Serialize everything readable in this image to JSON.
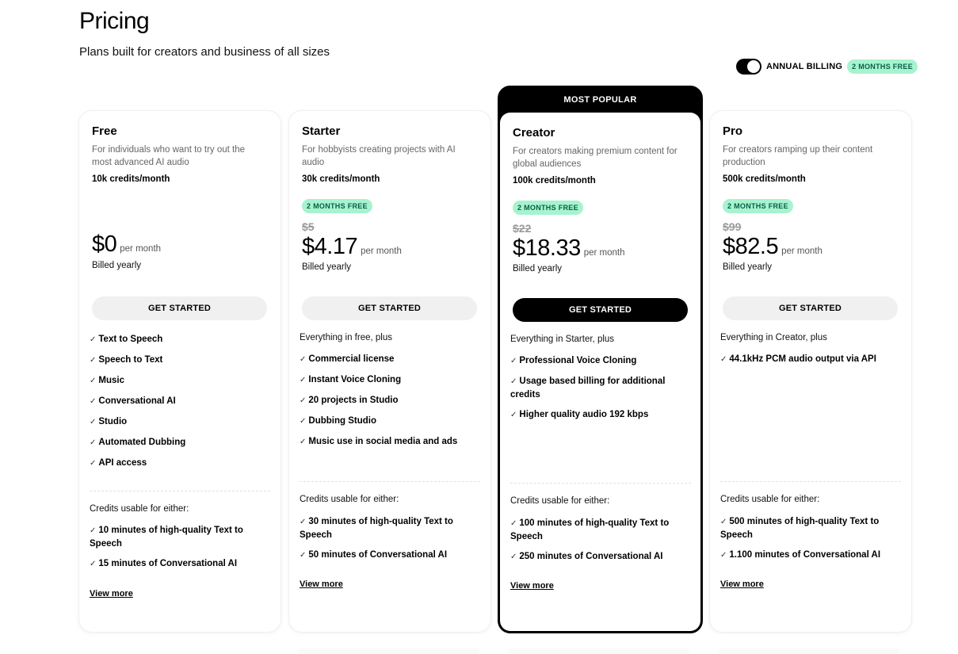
{
  "header": {
    "title": "Pricing",
    "subtitle": "Plans built for creators and business of all sizes"
  },
  "billing": {
    "label": "ANNUAL BILLING",
    "badge": "2 MONTHS FREE",
    "enabled": true
  },
  "colors": {
    "accent_badge_bg": "#a7f3cf",
    "accent_badge_text": "#065f46",
    "primary": "#000000"
  },
  "plans": [
    {
      "name": "Free",
      "description": "For individuals who want to try out the most advanced AI audio",
      "credits": "10k credits/month",
      "price": "$0",
      "per": "per month",
      "billed": "Billed yearly",
      "cta": "GET STARTED",
      "features": [
        "Text to Speech",
        "Speech to Text",
        "Music",
        "Conversational AI",
        "Studio",
        "Automated Dubbing",
        "API access"
      ],
      "usable_label": "Credits usable for either:",
      "usable": [
        "10 minutes of high-quality Text to Speech",
        "15 minutes of Conversational AI"
      ],
      "view_more": "View more"
    },
    {
      "name": "Starter",
      "description": "For hobbyists creating projects with AI audio",
      "credits": "30k credits/month",
      "badge": "2 MONTHS FREE",
      "old_price": "$5",
      "price": "$4.17",
      "per": "per month",
      "billed": "Billed yearly",
      "cta": "GET STARTED",
      "intro": "Everything in free, plus",
      "features": [
        "Commercial license",
        "Instant Voice Cloning",
        "20 projects in Studio",
        "Dubbing Studio",
        "Music use in social media and ads"
      ],
      "usable_label": "Credits usable for either:",
      "usable": [
        "30 minutes of high-quality Text to Speech",
        "50 minutes of Conversational AI"
      ],
      "view_more": "View more"
    },
    {
      "name": "Creator",
      "popular_label": "MOST POPULAR",
      "description": "For creators making premium content for global audiences",
      "credits": "100k credits/month",
      "badge": "2 MONTHS FREE",
      "old_price": "$22",
      "price": "$18.33",
      "per": "per month",
      "billed": "Billed yearly",
      "cta": "GET STARTED",
      "intro": "Everything in Starter, plus",
      "features": [
        "Professional Voice Cloning",
        "Usage based billing for additional credits",
        "Higher quality audio 192 kbps"
      ],
      "usable_label": "Credits usable for either:",
      "usable": [
        "100 minutes of high-quality Text to Speech",
        "250 minutes of Conversational AI"
      ],
      "view_more": "View more"
    },
    {
      "name": "Pro",
      "description": "For creators ramping up their content production",
      "credits": "500k credits/month",
      "badge": "2 MONTHS FREE",
      "old_price": "$99",
      "price": "$82.5",
      "per": "per month",
      "billed": "Billed yearly",
      "cta": "GET STARTED",
      "intro": "Everything in Creator, plus",
      "features": [
        "44.1kHz PCM audio output via API"
      ],
      "usable_label": "Credits usable for either:",
      "usable": [
        "500 minutes of high-quality Text to Speech",
        "1.100 minutes of Conversational AI"
      ],
      "view_more": "View more"
    }
  ]
}
